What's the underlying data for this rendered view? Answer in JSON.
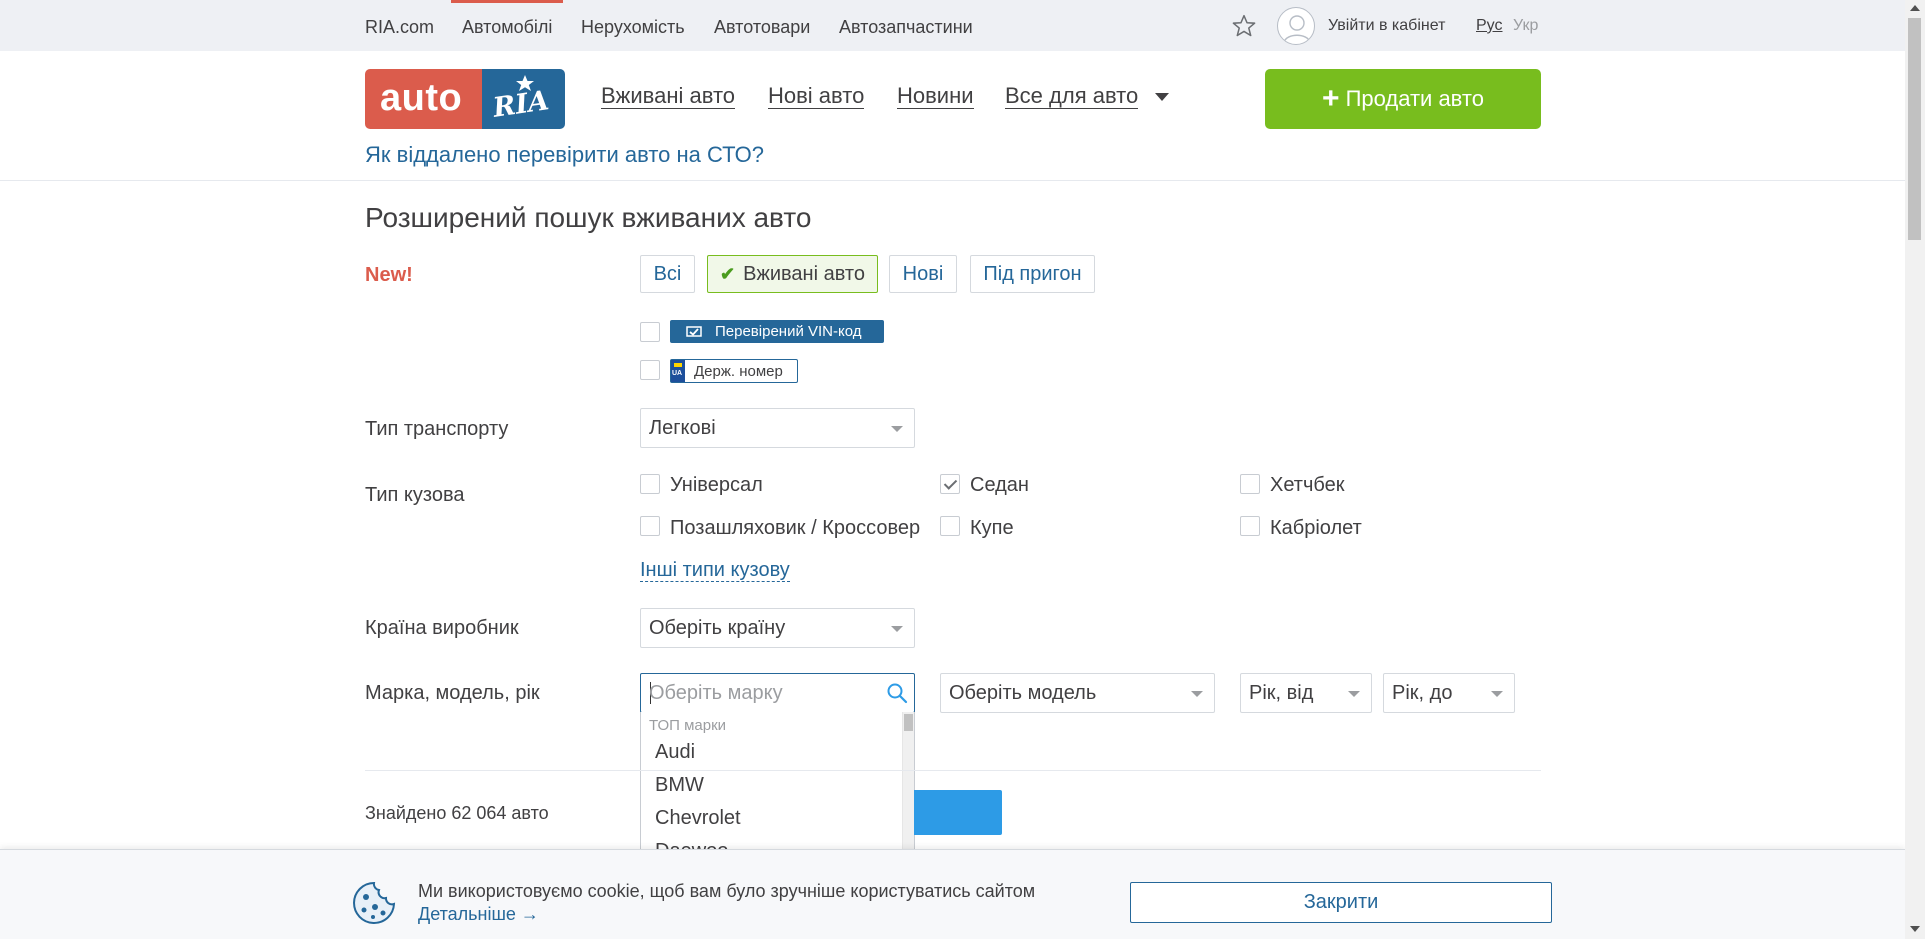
{
  "topnav": {
    "items": [
      {
        "label": "RIA.com"
      },
      {
        "label": "Автомобілі",
        "active": true
      },
      {
        "label": "Нерухомість"
      },
      {
        "label": "Автотовари"
      },
      {
        "label": "Автозапчастини"
      }
    ],
    "login_label": "Увійти в кабінет",
    "lang_ru": "Рус",
    "lang_uk": "Укр",
    "favorites_icon": "star-icon",
    "avatar_icon": "user-avatar-icon"
  },
  "header": {
    "logo_auto": "auto",
    "logo_ria": "RIA",
    "nav": [
      "Вживані авто",
      "Нові авто",
      "Новини",
      "Все для авто"
    ],
    "sell_button": "Продати авто",
    "promo_link": "Як віддалено перевірити авто на СТО?"
  },
  "colors": {
    "brand_red": "#db5c4c",
    "brand_blue": "#256799",
    "sell_green": "#78bd1e",
    "action_blue": "#2d9be6"
  },
  "search": {
    "title": "Розширений пошук вживаних авто",
    "new_label": "New!",
    "segments": [
      {
        "label": "Всі",
        "active": false
      },
      {
        "label": "Вживані авто",
        "active": true
      },
      {
        "label": "Нові",
        "active": false
      },
      {
        "label": "Під пригон",
        "active": false
      }
    ],
    "vin_badge": "Перевірений VIN-код",
    "vin_checked": false,
    "plate_badge": "Держ. номер",
    "plate_flag_text": "UA",
    "plate_checked": false,
    "transport_label": "Тип транспорту",
    "transport_value": "Легкові",
    "body_label": "Тип кузова",
    "body_types": [
      {
        "label": "Універсал",
        "checked": false
      },
      {
        "label": "Седан",
        "checked": true
      },
      {
        "label": "Хетчбек",
        "checked": false
      },
      {
        "label": "Позашляховик / Кроссовер",
        "checked": false
      },
      {
        "label": "Купе",
        "checked": false
      },
      {
        "label": "Кабріолет",
        "checked": false
      }
    ],
    "more_body_types": "Інші типи кузову",
    "country_label": "Країна виробник",
    "country_placeholder": "Оберіть країну",
    "brand_label": "Марка, модель, рік",
    "brand_placeholder": "Оберіть марку",
    "model_placeholder": "Оберіть модель",
    "year_from": "Рік, від",
    "year_to": "Рік, до",
    "dropdown": {
      "header": "ТОП марки",
      "items": [
        "Audi",
        "BMW",
        "Chevrolet",
        "Daewoo"
      ]
    },
    "found_text": "Знайдено 62 064 авто"
  },
  "cookie": {
    "text": "Ми використовуємо cookie, щоб вам було зручніше користуватись сайтом",
    "more": "Детальніше →",
    "close": "Закрити"
  }
}
